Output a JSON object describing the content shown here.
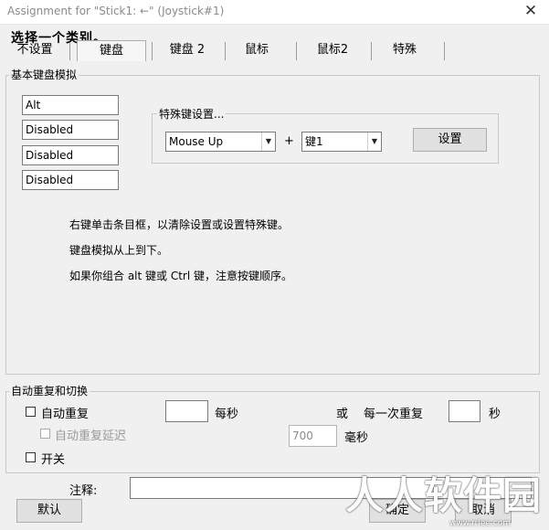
{
  "window": {
    "title": "Assignment for \"Stick1: ←\" (Joystick#1)",
    "close_glyph": "✕"
  },
  "heading": "选择一个类别。",
  "tabs": [
    {
      "label": "不设置"
    },
    {
      "label": "键盘",
      "active": true
    },
    {
      "label": "键盘 2"
    },
    {
      "label": "鼠标"
    },
    {
      "label": "鼠标2"
    },
    {
      "label": "特殊"
    }
  ],
  "basic_group": {
    "title": "基本键盘模拟",
    "key_slots": [
      "Alt",
      "Disabled",
      "Disabled",
      "Disabled"
    ],
    "special": {
      "title": "特殊键设置...",
      "combo1": "Mouse Up",
      "plus": "+",
      "combo2": "键1",
      "set_button": "设置"
    },
    "info_lines": [
      "右键单击条目框，以清除设置或设置特殊键。",
      "键盘模拟从上到下。",
      "如果你组合 alt 键或 Ctrl 键，注意按键顺序。"
    ]
  },
  "repeat_group": {
    "title": "自动重复和切换",
    "auto_repeat_label": "自动重复",
    "rate_value": "",
    "per_second_label": "每秒",
    "or_label": "或",
    "every_label": "每一次重复",
    "interval_value": "",
    "seconds_label": "秒",
    "delay_label": "自动重复延迟",
    "delay_value": "700",
    "ms_label": "毫秒",
    "toggle_label": "开关"
  },
  "note_label": "注释:",
  "note_value": "",
  "buttons": {
    "default": "默认",
    "ok_partial": "确定",
    "cancel_partial": "取消"
  },
  "watermark": {
    "text": "人人软件园",
    "url": "www.rrlee.com"
  }
}
